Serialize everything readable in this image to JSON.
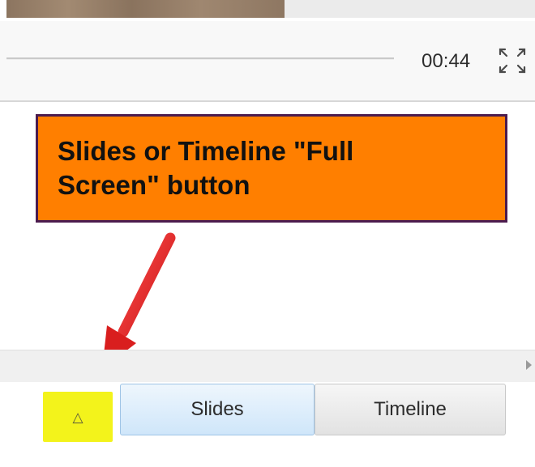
{
  "player": {
    "time": "00:44",
    "fullscreen_icon": "expand-arrows-icon"
  },
  "callout": {
    "line1": "Slides or Timeline \"Full",
    "line2": "Screen\" button"
  },
  "bottom": {
    "fullscreen_button_glyph": "△",
    "tabs": [
      {
        "label": "Slides",
        "selected": true
      },
      {
        "label": "Timeline",
        "selected": false
      }
    ]
  },
  "colors": {
    "callout_fill": "#ff7f00",
    "callout_border": "#4b1b4e",
    "highlight": "#f3f31b",
    "arrow": "#e32626",
    "selected_tab": "#cfe6fa"
  }
}
